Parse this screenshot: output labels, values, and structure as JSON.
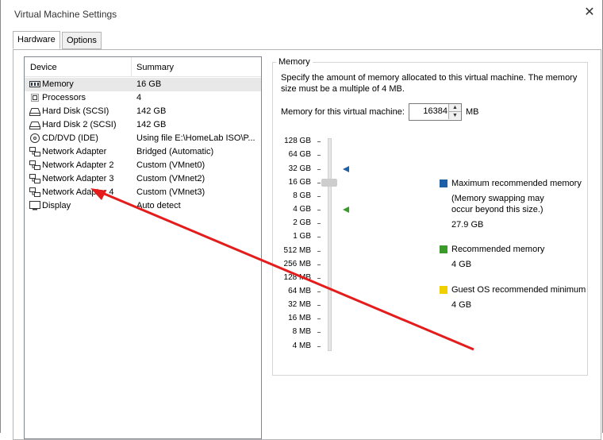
{
  "window": {
    "title": "Virtual Machine Settings"
  },
  "tabs": [
    {
      "label": "Hardware"
    },
    {
      "label": "Options"
    }
  ],
  "device_list": {
    "columns": [
      "Device",
      "Summary"
    ],
    "rows": [
      {
        "device": "Memory",
        "summary": "16 GB",
        "icon": "memory-icon"
      },
      {
        "device": "Processors",
        "summary": "4",
        "icon": "processor-icon"
      },
      {
        "device": "Hard Disk (SCSI)",
        "summary": "142 GB",
        "icon": "hard-disk-icon"
      },
      {
        "device": "Hard Disk 2 (SCSI)",
        "summary": "142 GB",
        "icon": "hard-disk-icon"
      },
      {
        "device": "CD/DVD (IDE)",
        "summary": "Using file E:\\HomeLab ISO\\P...",
        "icon": "cd-dvd-icon"
      },
      {
        "device": "Network Adapter",
        "summary": "Bridged (Automatic)",
        "icon": "network-adapter-icon"
      },
      {
        "device": "Network Adapter 2",
        "summary": "Custom (VMnet0)",
        "icon": "network-adapter-icon"
      },
      {
        "device": "Network Adapter 3",
        "summary": "Custom (VMnet2)",
        "icon": "network-adapter-icon"
      },
      {
        "device": "Network Adapter 4",
        "summary": "Custom (VMnet3)",
        "icon": "network-adapter-icon"
      },
      {
        "device": "Display",
        "summary": "Auto detect",
        "icon": "display-icon"
      }
    ]
  },
  "memory": {
    "group_title": "Memory",
    "description": "Specify the amount of memory allocated to this virtual machine. The memory size must be a multiple of 4 MB.",
    "field_label": "Memory for this virtual machine:",
    "value": "16384",
    "unit": "MB",
    "scale_labels": [
      "128 GB",
      "64 GB",
      "32 GB",
      "16 GB",
      "8 GB",
      "4 GB",
      "2 GB",
      "1 GB",
      "512 MB",
      "256 MB",
      "128 MB",
      "64 MB",
      "32 MB",
      "16 MB",
      "8 MB",
      "4 MB"
    ],
    "legend": {
      "max": {
        "label": "Maximum recommended memory",
        "note": "(Memory swapping may occur beyond this size.)",
        "value": "27.9 GB",
        "color": "#1f5fa8"
      },
      "recommended": {
        "label": "Recommended memory",
        "value": "4 GB",
        "color": "#3a9a2a"
      },
      "guest_min": {
        "label": "Guest OS recommended minimum",
        "value": "4 GB",
        "color": "#f0d000"
      }
    }
  },
  "colors": {
    "annotation_arrow": "#e41c1c"
  }
}
